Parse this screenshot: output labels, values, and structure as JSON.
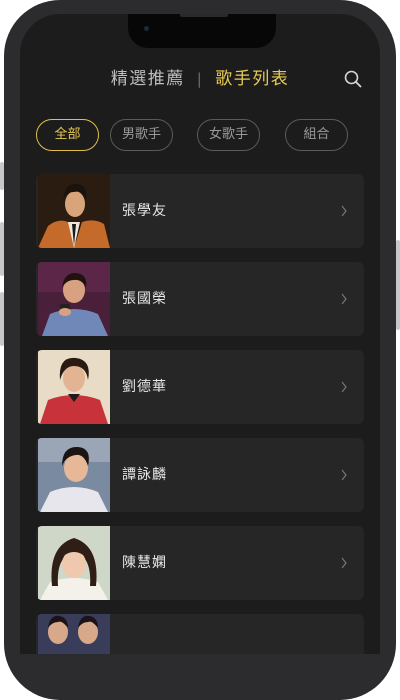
{
  "header": {
    "tab_featured": "精選推薦",
    "separator": "|",
    "tab_singers": "歌手列表",
    "search_icon": "search-icon"
  },
  "filters": [
    {
      "label": "全部",
      "active": true
    },
    {
      "label": "男歌手",
      "active": false
    },
    {
      "label": "女歌手",
      "active": false
    },
    {
      "label": "組合",
      "active": false
    }
  ],
  "artists": [
    {
      "name": "張學友"
    },
    {
      "name": "張國榮"
    },
    {
      "name": "劉德華"
    },
    {
      "name": "譚詠麟"
    },
    {
      "name": "陳慧嫻"
    },
    {
      "name": ""
    }
  ],
  "colors": {
    "accent": "#e8cb55",
    "background": "#1c1c1c",
    "card": "#262626",
    "text": "#e6e6e6"
  }
}
